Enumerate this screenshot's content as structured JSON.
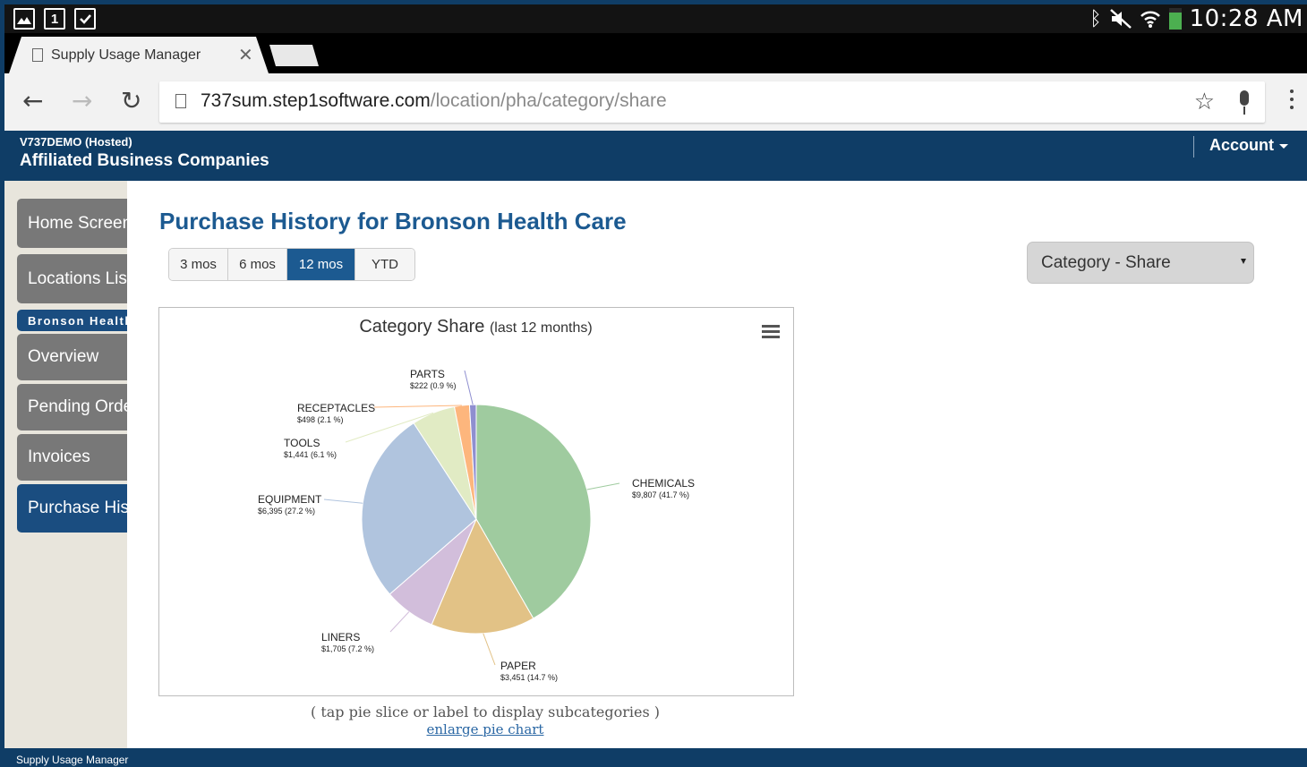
{
  "status_bar": {
    "time": "10:28 AM",
    "left_icons": [
      "gallery-icon",
      "calendar-icon",
      "clipboard-check-icon"
    ],
    "calendar_day": "1",
    "right_icons": [
      "bluetooth-icon",
      "mute-icon",
      "wifi-icon",
      "battery-icon"
    ]
  },
  "browser": {
    "tab_title": "Supply Usage Manager",
    "url_host": "737sum.step1software.com",
    "url_path": "/location/pha/category/share"
  },
  "header": {
    "subtitle": "V737DEMO (Hosted)",
    "company": "Affiliated Business Companies",
    "account_label": "Account"
  },
  "sidebar": {
    "items": [
      {
        "label": "Home Screen"
      },
      {
        "label": "Locations List"
      },
      {
        "label": "Bronson Health Care"
      },
      {
        "label": "Overview"
      },
      {
        "label": "Pending Orders"
      },
      {
        "label": "Invoices"
      },
      {
        "label": "Purchase History"
      }
    ]
  },
  "main": {
    "title": "Purchase History for Bronson Health Care",
    "ranges": [
      {
        "label": "3 mos",
        "active": false
      },
      {
        "label": "6 mos",
        "active": false
      },
      {
        "label": "12 mos",
        "active": true
      },
      {
        "label": "YTD",
        "active": false
      }
    ],
    "view_select": "Category - Share",
    "chart_title": "Category Share",
    "chart_title_suffix": "(last 12 months)",
    "hint": "( tap pie slice or label to display subcategories )",
    "enlarge_link": "enlarge pie chart"
  },
  "chart_data": {
    "type": "pie",
    "title": "Category Share",
    "subtitle": "(last 12 months)",
    "slices": [
      {
        "name": "CHEMICALS",
        "value": 9807,
        "value_label": "$9,807 (41.7 %)",
        "percent": 41.7,
        "color": "#9fcb9f"
      },
      {
        "name": "PAPER",
        "value": 3451,
        "value_label": "$3,451 (14.7 %)",
        "percent": 14.7,
        "color": "#e2c286"
      },
      {
        "name": "LINERS",
        "value": 1705,
        "value_label": "$1,705 (7.2 %)",
        "percent": 7.2,
        "color": "#d2bedb"
      },
      {
        "name": "EQUIPMENT",
        "value": 6395,
        "value_label": "$6,395 (27.2 %)",
        "percent": 27.2,
        "color": "#b0c4de"
      },
      {
        "name": "TOOLS",
        "value": 1441,
        "value_label": "$1,441 (6.1 %)",
        "percent": 6.1,
        "color": "#e1ebc4"
      },
      {
        "name": "RECEPTACLES",
        "value": 498,
        "value_label": "$498 (2.1 %)",
        "percent": 2.1,
        "color": "#fdb67d"
      },
      {
        "name": "PARTS",
        "value": 222,
        "value_label": "$222 (0.9 %)",
        "percent": 0.9,
        "color": "#8f8fd0"
      }
    ]
  },
  "footer": {
    "text": "Supply Usage Manager"
  }
}
